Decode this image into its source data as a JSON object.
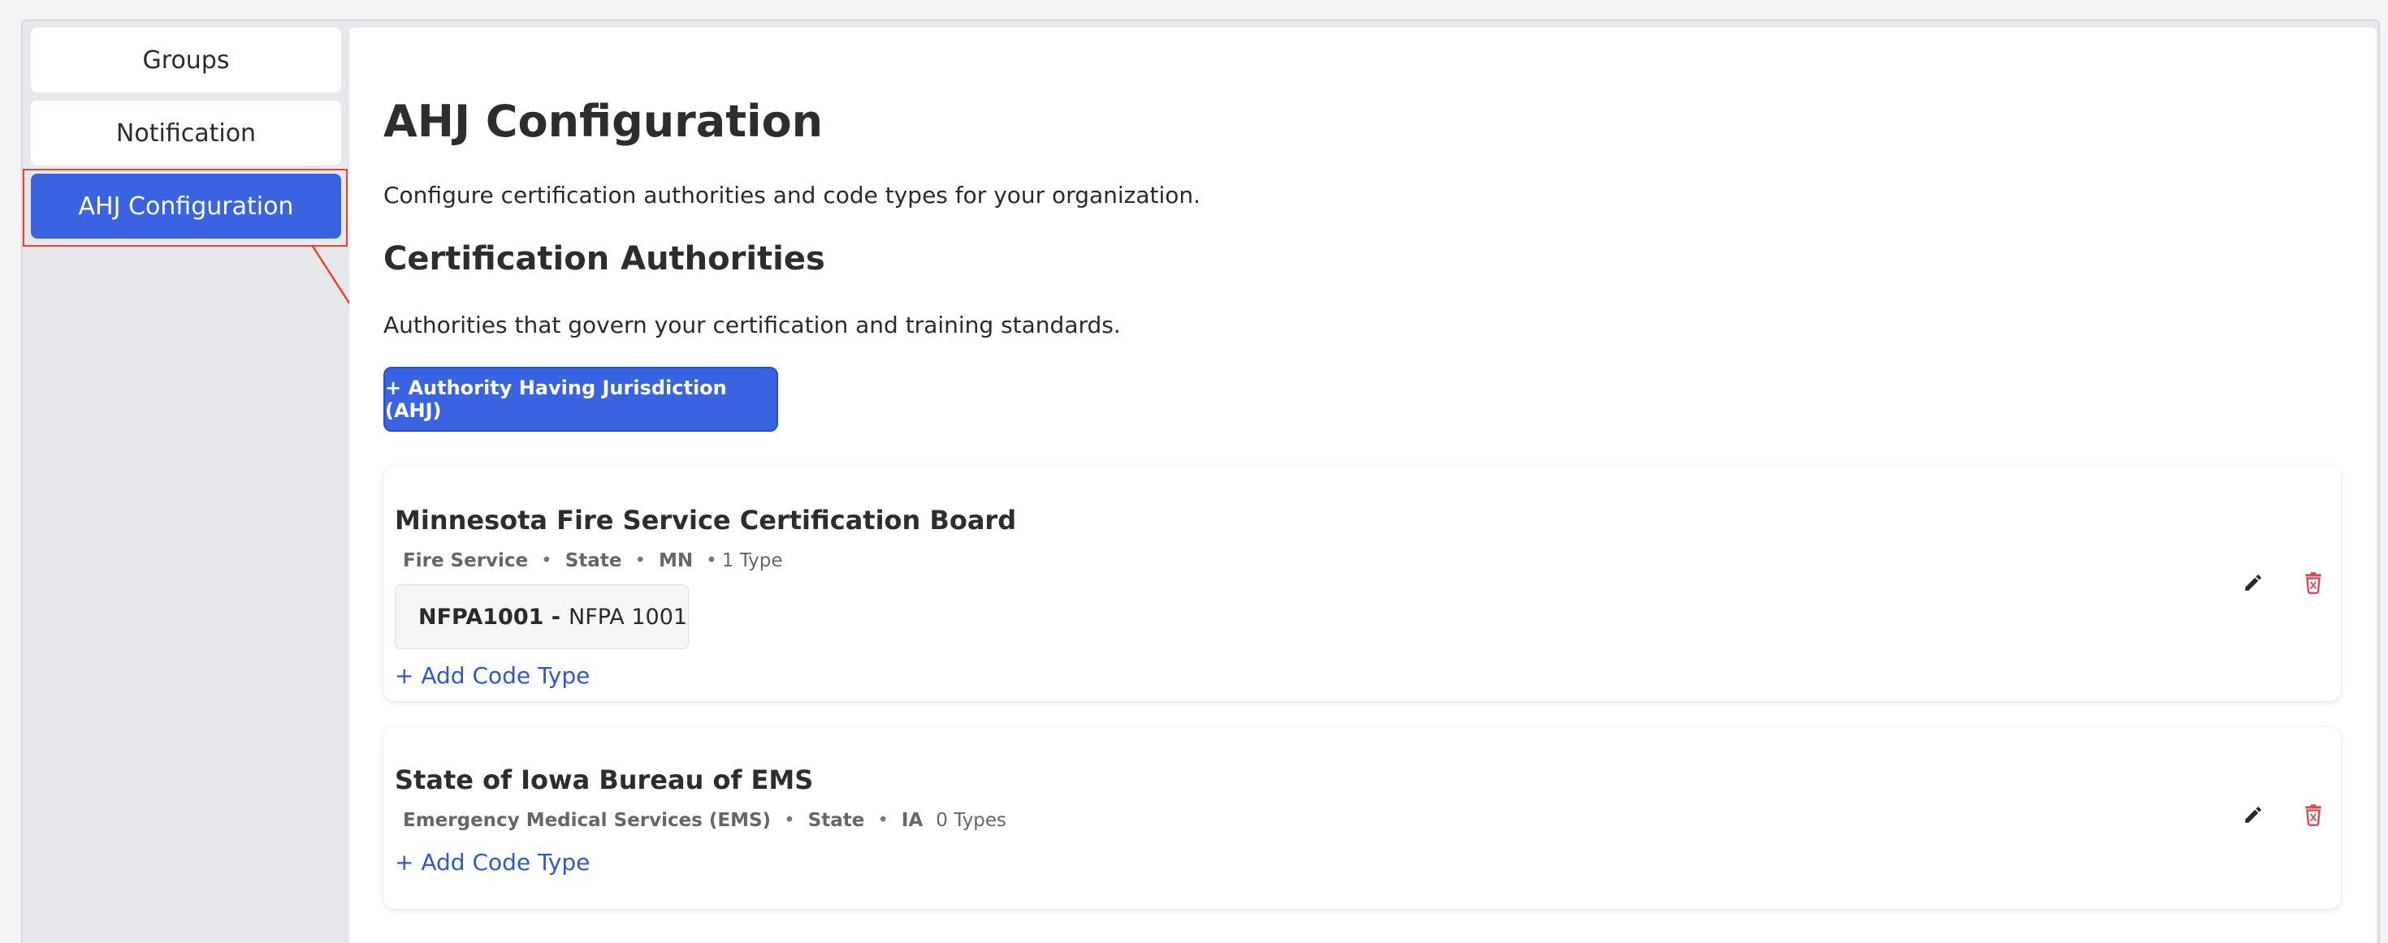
{
  "sidebar": {
    "items": [
      {
        "label": "Groups",
        "active": false
      },
      {
        "label": "Notification",
        "active": false
      },
      {
        "label": "AHJ Configuration",
        "active": true
      }
    ]
  },
  "main": {
    "title": "AHJ Configuration",
    "description": "Configure certification authorities and code types for your organization.",
    "section_title": "Certification Authorities",
    "section_description": "Authorities that govern your certification and training standards.",
    "add_button_label": "+ Authority Having Jurisdiction (AHJ)"
  },
  "authorities": [
    {
      "name": "Minnesota Fire Service Certification Board",
      "discipline": "Fire Service",
      "level": "State",
      "state": "MN",
      "type_count": "1 Type",
      "codes": [
        {
          "code": "NFPA1001 -",
          "name": "NFPA 1001"
        }
      ],
      "add_code_label": "+ Add Code Type"
    },
    {
      "name": "State of Iowa Bureau of EMS",
      "discipline": "Emergency Medical Services (EMS)",
      "level": "State",
      "state": "IA",
      "type_count": "0 Types",
      "codes": [],
      "add_code_label": "+ Add Code Type"
    }
  ],
  "meta_separator": "•",
  "icons": {
    "edit": "pencil-icon",
    "delete": "trash-icon"
  },
  "colors": {
    "accent": "#3a63e2",
    "link": "#2e57d6",
    "delete": "#e0474c",
    "highlight": "#e8432b"
  }
}
